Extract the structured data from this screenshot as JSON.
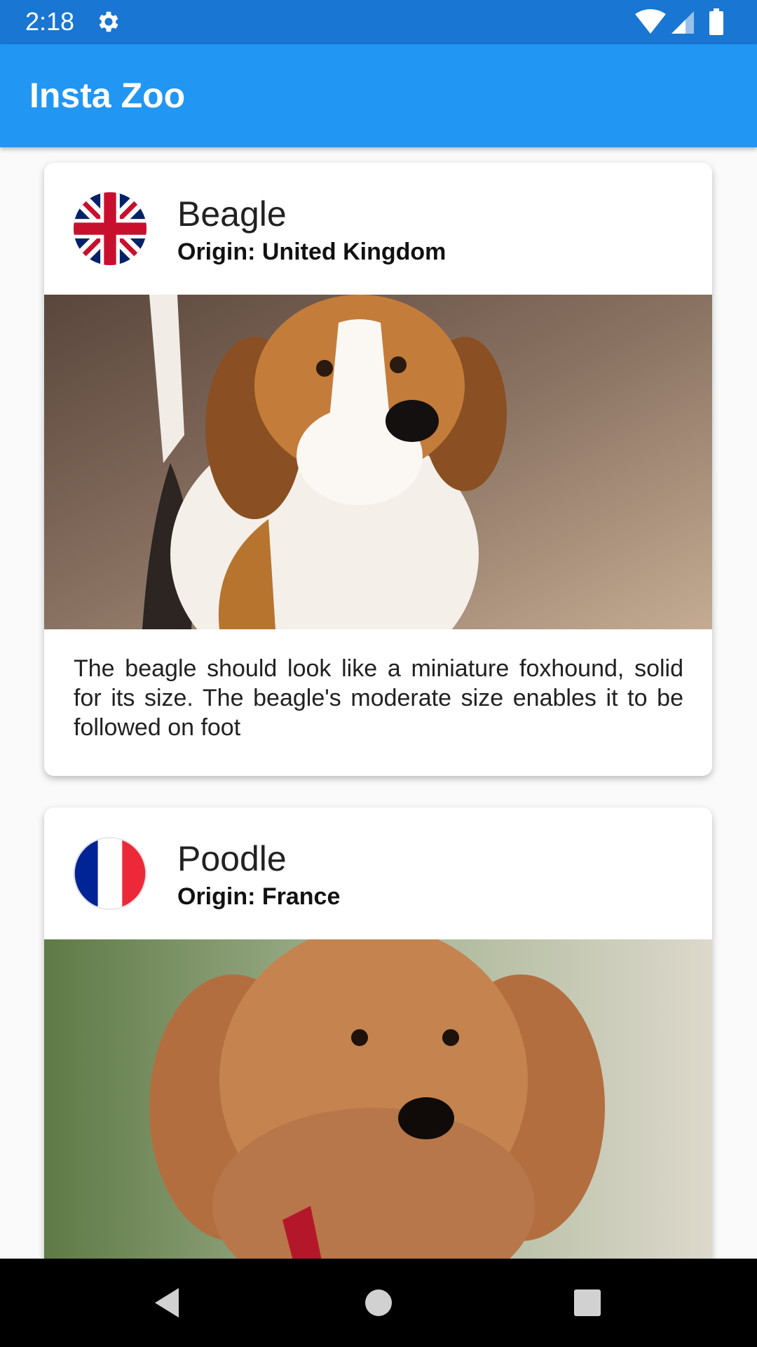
{
  "status_bar": {
    "time": "2:18",
    "icons": [
      "settings-gear-icon",
      "wifi-icon",
      "cell-signal-icon",
      "battery-icon"
    ]
  },
  "app_bar": {
    "title": "Insta Zoo",
    "color": "#2196f3"
  },
  "feed": {
    "cards": [
      {
        "name": "Beagle",
        "origin": "Origin: United Kingdom",
        "flag_icon": "uk-flag-icon",
        "photo": "beagle-photo",
        "description": "The beagle should look like a miniature foxhound, solid for its size. The beagle's moderate size enables it to be followed on foot"
      },
      {
        "name": "Poodle",
        "origin": "Origin: France",
        "flag_icon": "france-flag-icon",
        "photo": "poodle-photo"
      }
    ]
  },
  "nav_bar": {
    "buttons": [
      "back-icon",
      "home-icon",
      "recents-icon"
    ]
  }
}
